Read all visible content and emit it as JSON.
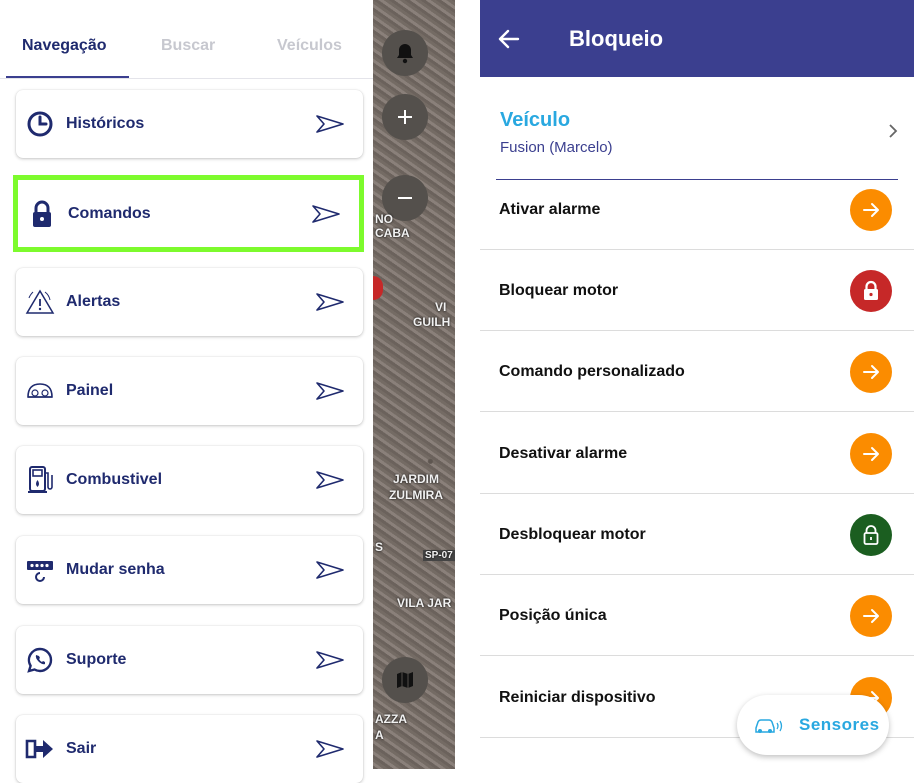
{
  "left_panel": {
    "tabs": [
      {
        "label": "Navegação",
        "active": true
      },
      {
        "label": "Buscar",
        "active": false
      },
      {
        "label": "Veículos",
        "active": false
      }
    ],
    "menu": [
      {
        "label": "Históricos",
        "icon": "clock-icon",
        "selected": false
      },
      {
        "label": "Comandos",
        "icon": "lock-icon",
        "selected": true
      },
      {
        "label": "Alertas",
        "icon": "warning-icon",
        "selected": false
      },
      {
        "label": "Painel",
        "icon": "speedometer-icon",
        "selected": false
      },
      {
        "label": "Combustivel",
        "icon": "fuel-pump-icon",
        "selected": false
      },
      {
        "label": "Mudar senha",
        "icon": "password-reset-icon",
        "selected": false
      },
      {
        "label": "Suporte",
        "icon": "whatsapp-icon",
        "selected": false
      },
      {
        "label": "Sair",
        "icon": "logout-icon",
        "selected": false
      }
    ],
    "colors": {
      "primary": "#1f2a6e",
      "selected_border": "#7dfb2d",
      "inactive_tab": "#c7c8cf"
    }
  },
  "map": {
    "labels": [
      "NO",
      "CABA",
      "VI",
      "GUILH",
      "JARDIM",
      "ZULMIRA",
      "S",
      "SP-07",
      "VILA JAR",
      "AZZA",
      "A"
    ]
  },
  "right_panel": {
    "title": "Bloqueio",
    "vehicle": {
      "title": "Veículo",
      "name": "Fusion (Marcelo)"
    },
    "commands": [
      {
        "label": "Ativar alarme",
        "button": "arrow",
        "color": "#fb8c00"
      },
      {
        "label": "Bloquear motor",
        "button": "lock",
        "color": "#c62828"
      },
      {
        "label": "Comando personalizado",
        "button": "arrow",
        "color": "#fb8c00"
      },
      {
        "label": "Desativar alarme",
        "button": "arrow",
        "color": "#fb8c00"
      },
      {
        "label": "Desbloquear motor",
        "button": "unlock",
        "color": "#1b5e20"
      },
      {
        "label": "Posição única",
        "button": "arrow",
        "color": "#fb8c00"
      },
      {
        "label": "Reiniciar dispositivo",
        "button": "arrow",
        "color": "#fb8c00"
      }
    ],
    "fab": {
      "label": "Sensores",
      "icon": "car-signal-icon"
    },
    "colors": {
      "appbar": "#3b3f8f",
      "accent": "#29a8e0"
    }
  }
}
